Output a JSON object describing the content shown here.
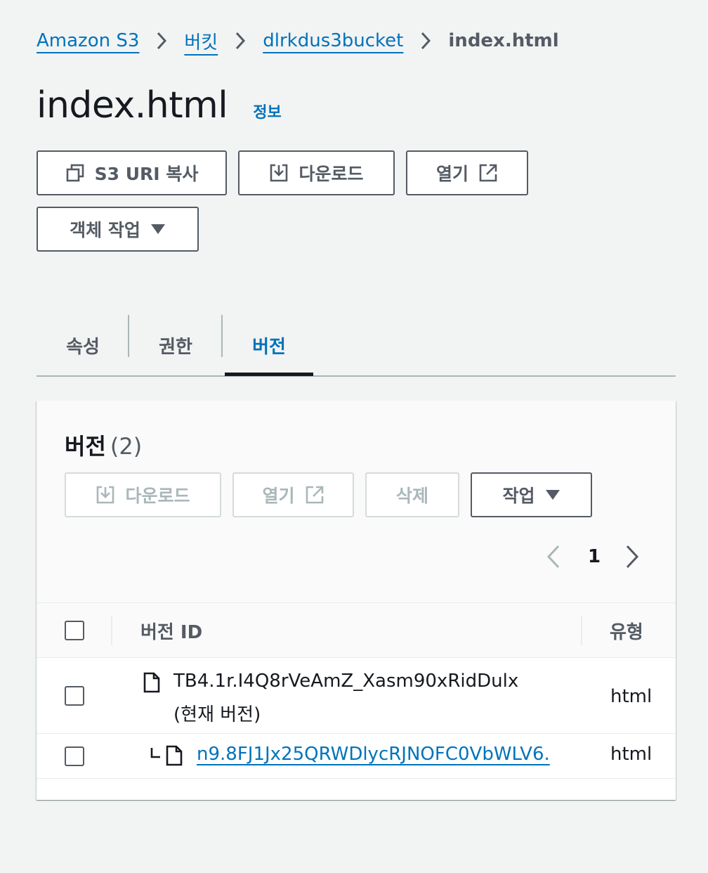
{
  "breadcrumb": {
    "items": [
      "Amazon S3",
      "버킷",
      "dlrkdus3bucket"
    ],
    "current": "index.html"
  },
  "header": {
    "title": "index.html",
    "info_label": "정보"
  },
  "toolbar": {
    "copy_uri_label": "S3 URI 복사",
    "download_label": "다운로드",
    "open_label": "열기",
    "object_actions_label": "객체 작업"
  },
  "tabs": [
    {
      "label": "속성",
      "active": false
    },
    {
      "label": "권한",
      "active": false
    },
    {
      "label": "버전",
      "active": true
    }
  ],
  "versions_panel": {
    "title": "버전",
    "count": "(2)",
    "actions": {
      "download_label": "다운로드",
      "open_label": "열기",
      "delete_label": "삭제",
      "actions_label": "작업"
    },
    "pagination": {
      "current_page": "1"
    },
    "table": {
      "columns": [
        "버전 ID",
        "유형"
      ],
      "rows": [
        {
          "version_id": "TB4.1r.I4Q8rVeAmZ_Xasm90xRidDulx",
          "note": "(현재 버전)",
          "type": "html",
          "is_current": true
        },
        {
          "version_id": "n9.8FJ1Jx25QRWDlycRJNOFC0VbWLV6.",
          "note": "",
          "type": "html",
          "is_current": false
        }
      ]
    }
  },
  "colors": {
    "link": "#0073bb",
    "text": "#16191f",
    "secondary_text": "#545b64",
    "disabled": "#aab7b8",
    "background": "#f2f3f3"
  }
}
